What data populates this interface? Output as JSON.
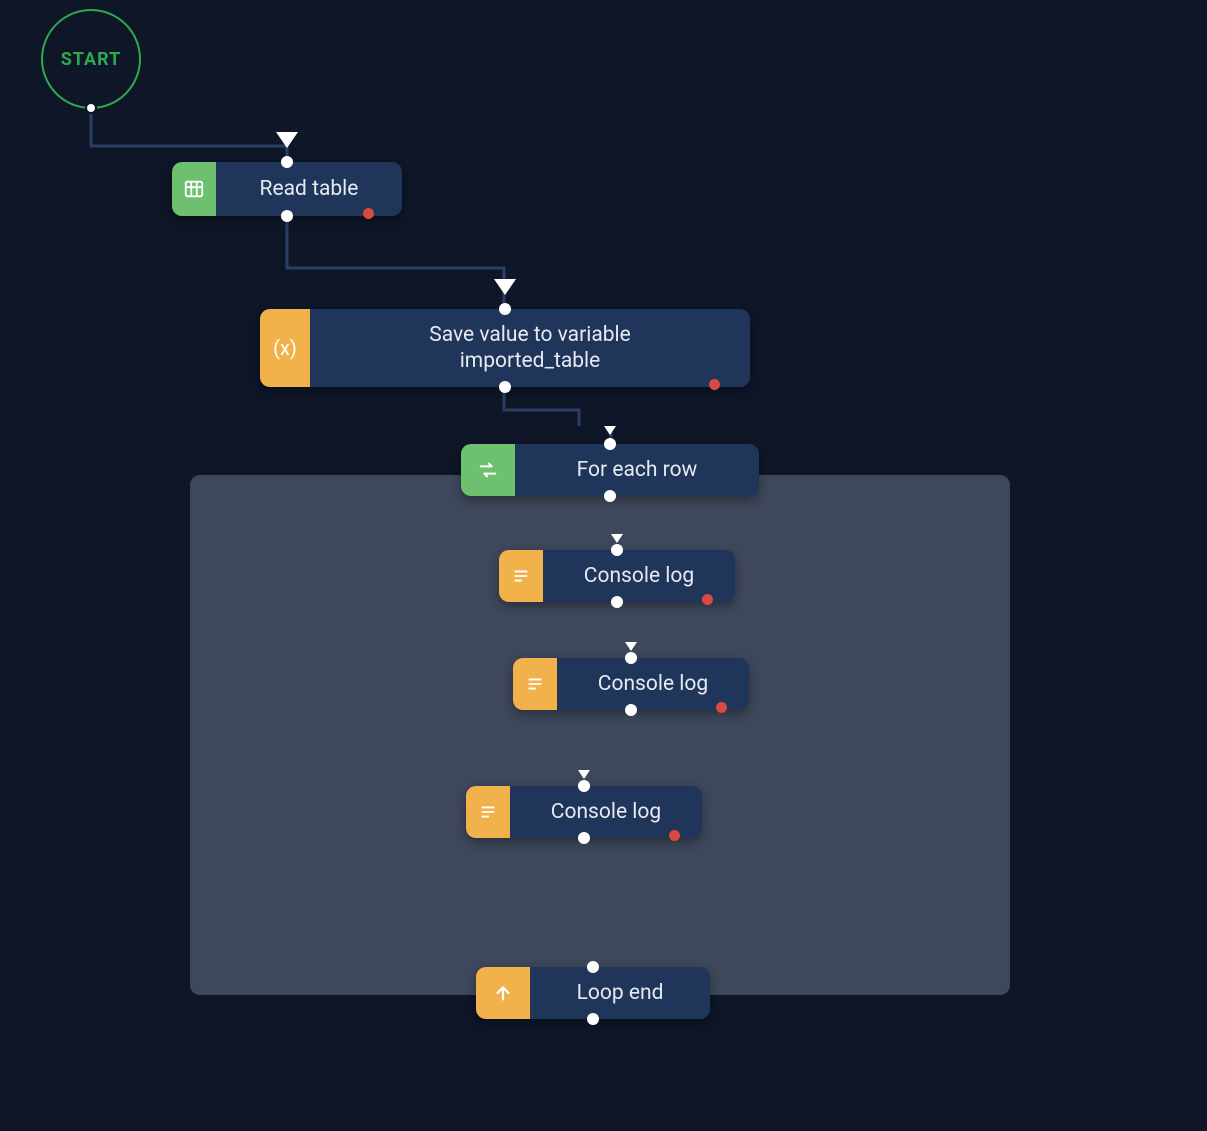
{
  "start": {
    "label": "START"
  },
  "nodes": {
    "read_table": {
      "label": "Read table",
      "icon": "table-icon",
      "icon_color": "green"
    },
    "save_var": {
      "label": "Save value to variable\nimported_table",
      "icon": "variable-icon",
      "icon_color": "orange"
    },
    "for_each": {
      "label": "For each row",
      "icon": "loop-icon",
      "icon_color": "green"
    },
    "console_log1": {
      "label": "Console log",
      "icon": "lines-icon",
      "icon_color": "orange"
    },
    "console_log2": {
      "label": "Console log",
      "icon": "lines-icon",
      "icon_color": "orange"
    },
    "console_log3": {
      "label": "Console log",
      "icon": "lines-icon",
      "icon_color": "orange"
    },
    "loop_end": {
      "label": "Loop end",
      "icon": "arrow-up-icon",
      "icon_color": "orange"
    }
  },
  "colors": {
    "bg": "#0e1628",
    "block_bg": "#1f3559",
    "green": "#6cc06e",
    "orange": "#f2b24b",
    "wire": "#2a3f66",
    "red_dot": "#d9493f",
    "loop_container": "#3e475b",
    "start_ring": "#2fa84f"
  }
}
